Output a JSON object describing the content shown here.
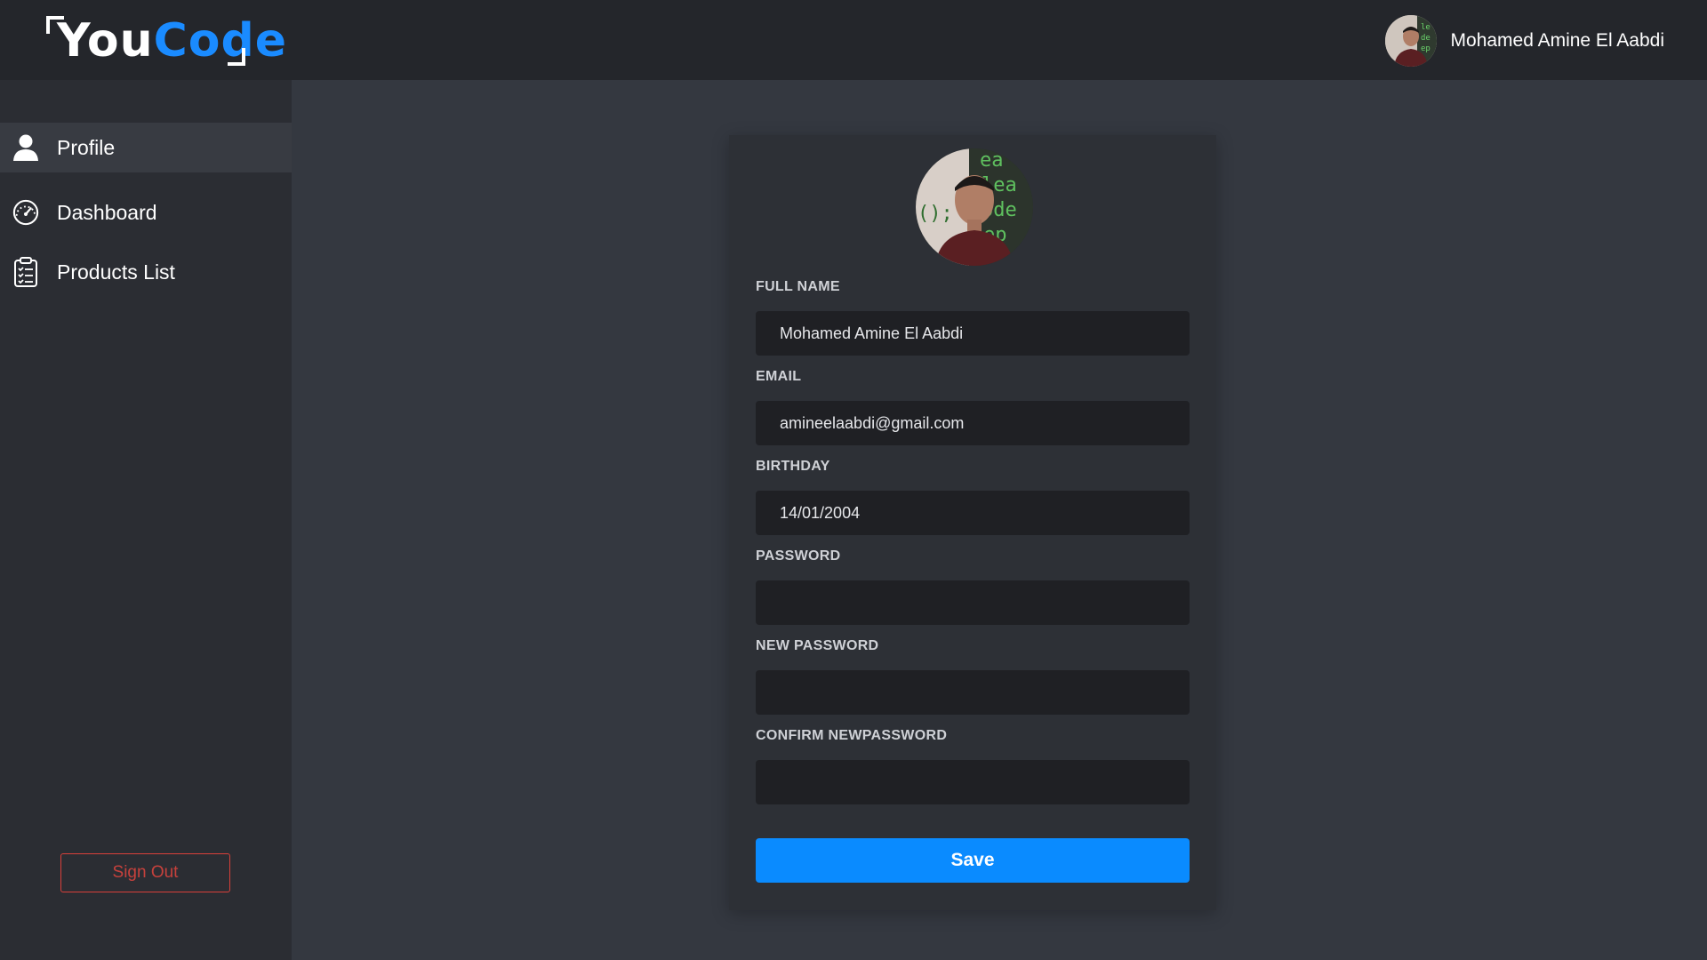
{
  "app": {
    "logo_you": "You",
    "logo_code": "Code",
    "accent_color": "#1a8bff",
    "danger_color": "#d9403a"
  },
  "header": {
    "user_name": "Mohamed Amine El Aabdi",
    "avatar_icon": "user-avatar"
  },
  "sidebar": {
    "items": [
      {
        "label": "Profile",
        "icon": "person-icon",
        "active": true
      },
      {
        "label": "Dashboard",
        "icon": "speedometer-icon",
        "active": false
      },
      {
        "label": "Products List",
        "icon": "clipboard-list-icon",
        "active": false
      }
    ],
    "signout_label": "Sign Out"
  },
  "form": {
    "full_name": {
      "label": "FULL NAME",
      "value": "Mohamed Amine El Aabdi"
    },
    "email": {
      "label": "EMAIL",
      "value": "amineelaabdi@gmail.com"
    },
    "birthday": {
      "label": "BIRTHDAY",
      "value": "14/01/2004"
    },
    "password": {
      "label": "PASSWORD",
      "value": ""
    },
    "new_password": {
      "label": "NEW PASSWORD",
      "value": ""
    },
    "confirm_new_password": {
      "label": "CONFIRM NEWPASSWORD",
      "value": ""
    },
    "save_label": "Save"
  }
}
